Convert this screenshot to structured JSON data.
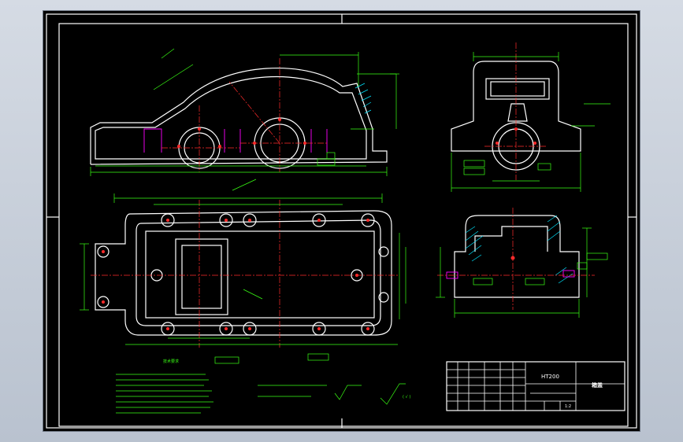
{
  "colors": {
    "background": "#000000",
    "outline": "#ffffff",
    "dimension": "#39ff14",
    "centerline": "#ff2b2b",
    "bolt": "#ff00ff",
    "hatch": "#00e5ff"
  },
  "drawing": {
    "title_block": {
      "material": "HT200",
      "part_name": "箱盖",
      "scale": "1:2"
    },
    "notes": {
      "heading": "技术要求",
      "roughness_hint": "( √ )"
    }
  }
}
